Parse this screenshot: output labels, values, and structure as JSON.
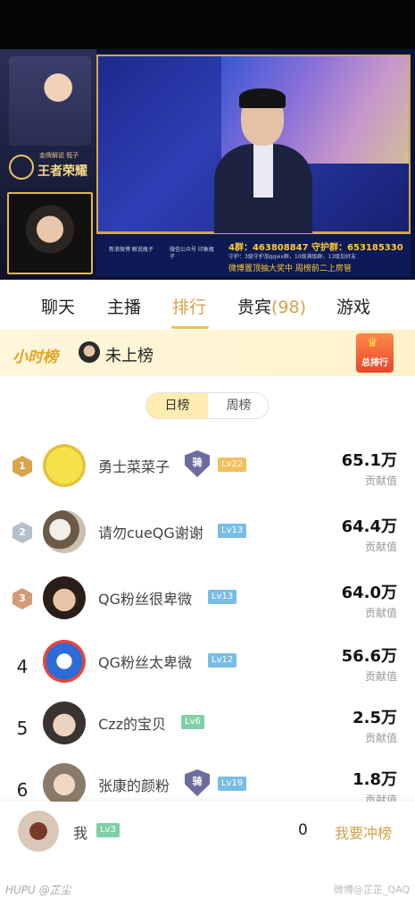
{
  "stream": {
    "caster_tag": "金牌解说 瓶子",
    "game_logo": "王者荣耀",
    "weibo_text": "新浪微博 解说瓶子",
    "wechat_text": "微信公众号 印象瓶子",
    "group_line": "4群：463808847   守护群：653185330",
    "guard_line": "守护：3级守护加qqwx群，10级满级群，13级加好友",
    "weibo_line": "微博置顶抽大奖中        周榜前二上房管"
  },
  "tabs": [
    {
      "label": "聊天"
    },
    {
      "label": "主播"
    },
    {
      "label": "排行"
    },
    {
      "label": "贵宾",
      "count": "(98)"
    },
    {
      "label": "游戏"
    }
  ],
  "hour_rank": {
    "title": "小时榜",
    "status": "未上榜",
    "total_button": "总排行",
    "crown_icon": "crown-icon"
  },
  "period_toggle": {
    "day": "日榜",
    "week": "周榜"
  },
  "leaderboard": [
    {
      "rank": "1",
      "name": "勇士菜菜子",
      "badge": "骑",
      "level": "Lv22",
      "amount": "65.1万",
      "amount_label": "贡献值"
    },
    {
      "rank": "2",
      "name": "请勿cueQG谢谢",
      "level": "Lv13",
      "amount": "64.4万",
      "amount_label": "贡献值"
    },
    {
      "rank": "3",
      "name": "QG粉丝很卑微",
      "level": "Lv13",
      "amount": "64.0万",
      "amount_label": "贡献值"
    },
    {
      "rank": "4",
      "name": "QG粉丝太卑微",
      "level": "Lv12",
      "amount": "56.6万",
      "amount_label": "贡献值"
    },
    {
      "rank": "5",
      "name": "Czz的宝贝",
      "level": "Lv6",
      "amount": "2.5万",
      "amount_label": "贡献值"
    },
    {
      "rank": "6",
      "name": "张康的颜粉",
      "badge": "骑",
      "level": "Lv19",
      "amount": "1.8万",
      "amount_label": "贡献值"
    }
  ],
  "me": {
    "name": "我",
    "level": "Lv3",
    "score": "0",
    "action": "我要冲榜"
  },
  "watermark": {
    "left": "HUPU @芷尘",
    "right": "微博@芷芷_QAQ"
  },
  "colors": {
    "accent_gold": "#d3a34a",
    "toggle_active_bg": "#ffecb0"
  }
}
